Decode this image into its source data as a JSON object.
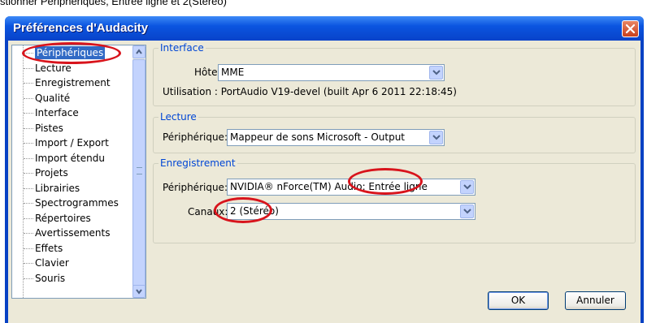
{
  "caption": "stionner Périphériques, Entrée ligne et 2(Stéréo)",
  "window": {
    "title": "Préférences d'Audacity"
  },
  "tree": {
    "items": [
      {
        "label": "Périphériques",
        "selected": true
      },
      {
        "label": "Lecture"
      },
      {
        "label": "Enregistrement"
      },
      {
        "label": "Qualité"
      },
      {
        "label": "Interface"
      },
      {
        "label": "Pistes"
      },
      {
        "label": "Import / Export"
      },
      {
        "label": "Import étendu"
      },
      {
        "label": "Projets"
      },
      {
        "label": "Librairies"
      },
      {
        "label": "Spectrogrammes"
      },
      {
        "label": "Répertoires"
      },
      {
        "label": "Avertissements"
      },
      {
        "label": "Effets"
      },
      {
        "label": "Clavier"
      },
      {
        "label": "Souris"
      }
    ]
  },
  "interface": {
    "legend": "Interface",
    "host_label": "Hôte:",
    "host_value": "MME",
    "usage_text": "Utilisation : PortAudio V19-devel (built Apr  6 2011 22:18:45)"
  },
  "playback": {
    "legend": "Lecture",
    "device_label": "Périphérique:",
    "device_value": "Mappeur de sons Microsoft - Output"
  },
  "recording": {
    "legend": "Enregistrement",
    "device_label": "Périphérique:",
    "device_value": "NVIDIA® nForce(TM) Audio: Entrée ligne",
    "channels_label": "Canaux:",
    "channels_value": "2 (Stéréo)"
  },
  "buttons": {
    "ok": "OK",
    "cancel": "Annuler"
  },
  "colors": {
    "titlebar": "#0b55e0",
    "dialog": "#ece9d8",
    "legend": "#0046d5",
    "annotation": "#d8141c",
    "selection": "#316ac5"
  },
  "icons": {
    "close": "close-icon",
    "dropdown": "chevron-down-icon",
    "scroll_up": "arrow-up-icon",
    "scroll_down": "arrow-down-icon"
  }
}
